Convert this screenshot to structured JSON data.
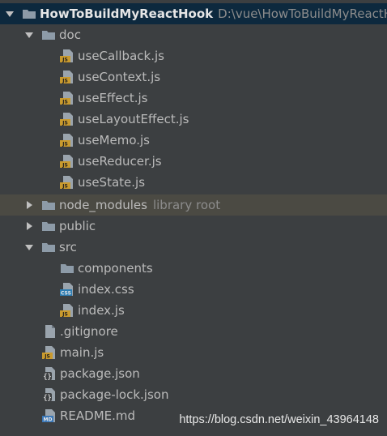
{
  "project": {
    "name": "HowToBuildMyReactHook",
    "path": "D:\\vue\\HowToBuildMyReactH"
  },
  "tree": {
    "doc": "doc",
    "doc_files": [
      "useCallback.js",
      "useContext.js",
      "useEffect.js",
      "useLayoutEffect.js",
      "useMemo.js",
      "useReducer.js",
      "useState.js"
    ],
    "node_modules": "node_modules",
    "node_modules_hint": "library root",
    "public": "public",
    "src": "src",
    "src_children": [
      "components",
      "index.css",
      "index.js"
    ],
    "root_files": [
      ".gitignore",
      "main.js",
      "package.json",
      "package-lock.json",
      "README.md"
    ]
  },
  "watermark": "https://blog.csdn.net/weixin_43964148",
  "colors": {
    "background": "#3c3f41",
    "root_selection": "#0d293e",
    "row_highlight": "#4b4a43",
    "folder": "#8d9ba8",
    "js_badge": "#c99a2e",
    "css_badge": "#2d7db3",
    "md_badge": "#3b78b8"
  },
  "icons": {
    "folder": "folder-icon",
    "js": "js-file-icon",
    "css": "css-file-icon",
    "json": "json-file-icon",
    "md": "markdown-file-icon",
    "text": "text-file-icon"
  }
}
